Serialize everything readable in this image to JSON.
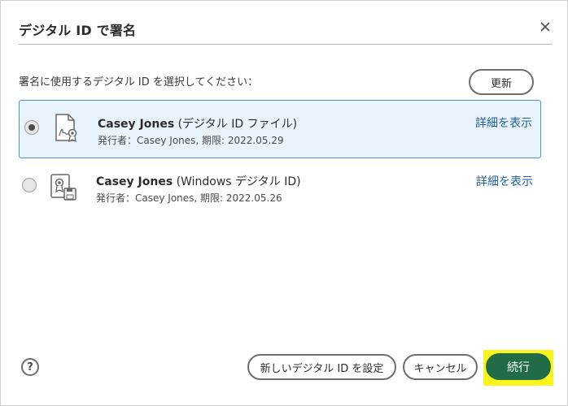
{
  "dialog": {
    "title": "デジタル ID で署名",
    "prompt": "署名に使用するデジタル ID を選択してください：",
    "refresh_label": "更新"
  },
  "ids": [
    {
      "name": "Casey Jones",
      "type": "(デジタル ID ファイル)",
      "subtitle": "発行者：Casey Jones, 期限: 2022.05.29",
      "detail_link": "詳細を表示",
      "selected": true,
      "icon": "certificate-file-icon"
    },
    {
      "name": "Casey Jones",
      "type": "(Windows デジタル ID)",
      "subtitle": "発行者：Casey Jones, 期限: 2022.05.26",
      "detail_link": "詳細を表示",
      "selected": false,
      "icon": "windows-cert-store-icon"
    }
  ],
  "footer": {
    "help_label": "?",
    "new_id_label": "新しいデジタル ID を設定",
    "cancel_label": "キャンセル",
    "continue_label": "続行"
  },
  "colors": {
    "selected_bg": "#e8f3fb",
    "selected_border": "#4c93d1",
    "primary": "#216b46",
    "highlight": "#f9f51c",
    "link": "#1f5f9e"
  }
}
